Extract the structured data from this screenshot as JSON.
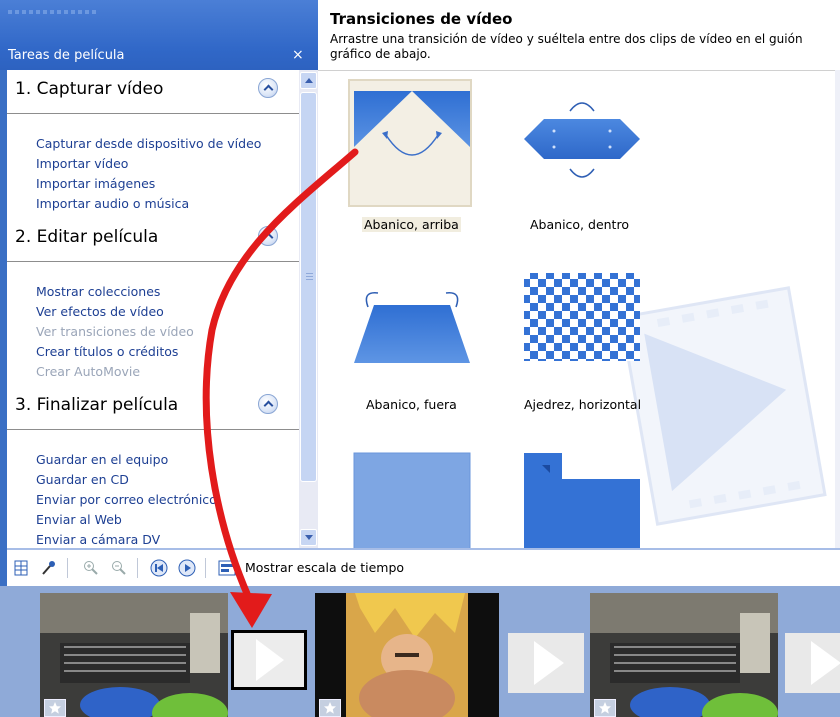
{
  "task_pane": {
    "title": "Tareas de película",
    "close_glyph": "×",
    "sections": [
      {
        "title": "1. Capturar vídeo",
        "links": [
          {
            "label": "Capturar desde dispositivo de vídeo",
            "disabled": false
          },
          {
            "label": "Importar vídeo",
            "disabled": false
          },
          {
            "label": "Importar imágenes",
            "disabled": false
          },
          {
            "label": "Importar audio o música",
            "disabled": false
          }
        ]
      },
      {
        "title": "2. Editar película",
        "links": [
          {
            "label": "Mostrar colecciones",
            "disabled": false
          },
          {
            "label": "Ver efectos de vídeo",
            "disabled": false
          },
          {
            "label": "Ver transiciones de vídeo",
            "disabled": true
          },
          {
            "label": "Crear títulos o créditos",
            "disabled": false
          },
          {
            "label": "Crear AutoMovie",
            "disabled": true
          }
        ]
      },
      {
        "title": "3. Finalizar película",
        "links": [
          {
            "label": "Guardar en el equipo",
            "disabled": false
          },
          {
            "label": "Guardar en CD",
            "disabled": false
          },
          {
            "label": "Enviar por correo electrónico",
            "disabled": false
          },
          {
            "label": "Enviar al Web",
            "disabled": false
          },
          {
            "label": "Enviar a cámara DV",
            "disabled": false
          }
        ]
      }
    ]
  },
  "transitions_panel": {
    "title": "Transiciones de vídeo",
    "description": "Arrastre una transición de vídeo y suéltela entre dos clips de vídeo en el guión gráfico de abajo.",
    "items": [
      {
        "label": "Abanico, arriba",
        "icon": "fan-up-icon",
        "selected": true
      },
      {
        "label": "Abanico, dentro",
        "icon": "fan-in-icon",
        "selected": false
      },
      {
        "label": "Abanico, fuera",
        "icon": "fan-out-icon",
        "selected": false
      },
      {
        "label": "Ajedrez, horizontal",
        "icon": "checkerboard-icon",
        "selected": false
      },
      {
        "label": "",
        "icon": "fade-icon",
        "selected": false
      },
      {
        "label": "",
        "icon": "corner-icon",
        "selected": false
      }
    ]
  },
  "toolbar": {
    "timeline_toggle_label": "Mostrar escala de tiempo",
    "icons": [
      "storyboard-icon",
      "narrate-icon",
      "zoom-in-icon",
      "zoom-out-icon",
      "rewind-icon",
      "play-icon",
      "timeline-icon"
    ]
  },
  "storyboard": {
    "clips": [
      "grill-clip",
      "cartoon-clip",
      "grill-clip"
    ],
    "transition_slots": 3
  },
  "colors": {
    "accent_blue": "#3168c8",
    "link_blue": "#1d3f93",
    "disabled_link": "#9aa5b8",
    "transition_blue": "#3a78d6",
    "drag_arrow": "#e21b1b",
    "storyboard_bg": "#8faad8"
  }
}
